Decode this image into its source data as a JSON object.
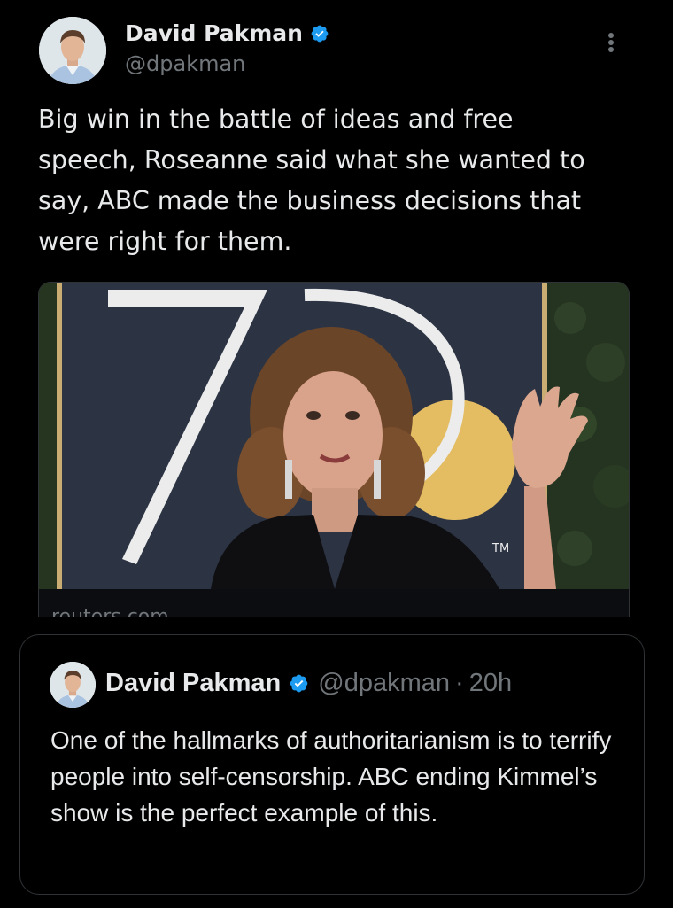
{
  "tweet": {
    "author_name": "David Pakman",
    "author_handle": "@dpakman",
    "text": "Big win in the battle of ideas and free speech, Roseanne said what she wanted to say, ABC made the business decisions that were right for them.",
    "media": {
      "icon": "photo-image",
      "domain": "reuters.com",
      "image_overlay_text": "TM"
    }
  },
  "quoted_tweet": {
    "author_name": "David Pakman",
    "author_handle": "@dpakman",
    "separator": "·",
    "time": "20h",
    "text": "One of the hallmarks of authoritarianism is to terrify people into self-censorship. ABC ending Kimmel’s show is the perfect example of this."
  },
  "icons": {
    "verified": "verified-badge-icon",
    "more": "more-vertical-icon"
  },
  "colors": {
    "background": "#000000",
    "text_primary": "#e7e9ea",
    "text_secondary": "#71767b",
    "verified": "#1d9bf0",
    "border": "#2f3336"
  }
}
